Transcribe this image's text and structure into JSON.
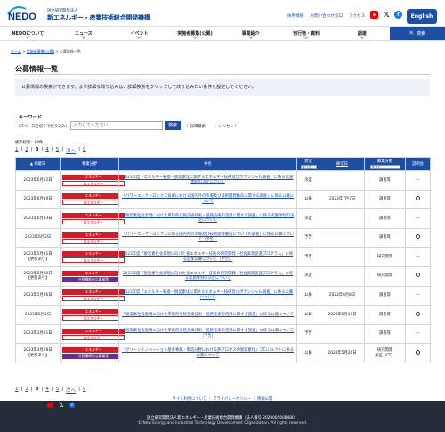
{
  "header": {
    "logo_text": "NEDO",
    "org_sub": "国立研究開発法人",
    "org_main": "新エネルギー・産業技術総合開発機構",
    "util_links": [
      "採用情報",
      "お問い合わせ窓口",
      "アクセス"
    ],
    "english_label": "English"
  },
  "nav": {
    "items": [
      "NEDOについて",
      "ニュース",
      "イベント",
      "実施者募集(公募)",
      "事業紹介",
      "刊行物・資料",
      "調達"
    ],
    "search_label": "🔍 検索"
  },
  "breadcrumb": [
    "ホーム",
    "実施者募集(公募)",
    "公募情報一覧"
  ],
  "page": {
    "title": "公募情報一覧",
    "intro": "公募情報の検索ができます。より詳細な絞り込みは、詳細検索をクリックして絞り込みたい条件を設定してください。"
  },
  "search": {
    "label": "キーワード",
    "sub_label": "(スペース区切りで絞り込み)",
    "placeholder": "入力してください",
    "button": "検索",
    "detail_label": "詳細検索",
    "reset_label": "リセット"
  },
  "results": {
    "count_text": "検索結果：88件",
    "pager": [
      "1",
      "2",
      "3",
      "4",
      "5",
      "次へ",
      "9"
    ],
    "current_page": "3"
  },
  "table": {
    "headers": {
      "date": "掲載日",
      "category": "事業分野",
      "title": "件名",
      "status": "状況",
      "status_filter": "すべて",
      "deadline": "締切日",
      "type": "募集分野",
      "type_filter": "すべて",
      "session": "説明会"
    },
    "rows": [
      {
        "date": "2023年6月22日",
        "cats": [
          {
            "t": "エネルギー",
            "k": "red"
          },
          {
            "t": "省エネルギー",
            "k": "outline"
          }
        ],
        "title": "2023年度「エネルギー転換・脱炭素化に関するエネルギー技術及びポテンシャル調査」に係る実施体制の決定について",
        "status": "決定",
        "deadline": "",
        "type": "調査等",
        "session": "—"
      },
      {
        "date": "2023年6月19日",
        "cats": [
          {
            "t": "エネルギー",
            "k": "red"
          },
          {
            "t": "省エネルギー",
            "k": "outline"
          }
        ],
        "title": "「パワーエレクトロニクス技術における国内外の市場及び技術開発動向に関する調査」に係る公募について",
        "status": "公募",
        "deadline": "2023年7月7日",
        "type": "調査等",
        "session": "○"
      },
      {
        "date": "2023年6月13日",
        "cats": [
          {
            "t": "エネルギー",
            "k": "red"
          },
          {
            "t": "省エネルギー",
            "k": "outline"
          }
        ],
        "title": "「脱炭素社会実現に向けた革新的な熱交換技術・低熱技術の活用に関する調査」に係る実施体制の決定について",
        "status": "決定",
        "deadline": "",
        "type": "調査等",
        "session": "—"
      },
      {
        "date": "2023年6月2日",
        "cats": [
          {
            "t": "エネルギー",
            "k": "red"
          },
          {
            "t": "省エネルギー",
            "k": "outline"
          }
        ],
        "title": "「パワーエレクトロニクスに係る国内外の市場及び技術開発動向についての調査」に係る公募について（予告）",
        "status": "予告",
        "deadline": "",
        "type": "調査等",
        "session": "○"
      },
      {
        "date": "2023年5月31日\n【更新あり】",
        "cats": [
          {
            "t": "エネルギー",
            "k": "red"
          },
          {
            "t": "省エネルギー",
            "k": "outline"
          }
        ],
        "title": "2023年度「脱炭素社会実現に向けた省エネルギー技術の研究開発・社会実装促進プログラム」に係る追加公募について（予告）",
        "status": "予告",
        "deadline": "",
        "type": "研究開発",
        "session": "—"
      },
      {
        "date": "2023年5月30日\n【更新あり】",
        "cats": [
          {
            "t": "エネルギー",
            "k": "red"
          },
          {
            "t": "分野横断的な事業等",
            "k": "purple"
          }
        ],
        "title": "2023年度「脱炭素社会実現に向けた省エネルギー技術の研究開発・社会実装促進プログラム」に係る実施体制の決定について",
        "status": "決定",
        "deadline": "",
        "type": "研究開発",
        "session": "○"
      },
      {
        "date": "2023年5月26日",
        "cats": [
          {
            "t": "エネルギー",
            "k": "red"
          },
          {
            "t": "省エネルギー",
            "k": "outline"
          }
        ],
        "title": "2023年度「エネルギー転換・脱炭素化に関するエネルギー技術及びポテンシャル調査」に係る公募について",
        "status": "公募",
        "deadline": "2023年6月8日",
        "type": "調査等",
        "session": "—"
      },
      {
        "date": "2023年5月1日",
        "cats": [
          {
            "t": "エネルギー",
            "k": "red"
          },
          {
            "t": "省エネルギー",
            "k": "outline"
          }
        ],
        "title": "「脱炭素社会実現に向けた革新的な熱交換技術・低熱技術の活用に関する調査」に係る公募について",
        "status": "公募",
        "deadline": "2023年5月30日",
        "type": "調査等",
        "session": "○"
      },
      {
        "date": "2023年3月31日",
        "cats": [
          {
            "t": "エネルギー",
            "k": "red"
          },
          {
            "t": "省エネルギー",
            "k": "outline"
          }
        ],
        "title": "「脱炭素社会実現に向けた革新的な熱交換技術・低熱技術の活用に関する調査」に係る公募について（予告）",
        "status": "予告",
        "deadline": "",
        "type": "調査等",
        "session": "—"
      },
      {
        "date": "2023年3月28日\n【更新あり】",
        "cats": [
          {
            "t": "エネルギー",
            "k": "red"
          },
          {
            "t": "分野横断的な事業等",
            "k": "purple"
          }
        ],
        "title": "「グリーンイノベーション基金事業／製造分野における熱プロセスの脱炭素化」プロジェクトに係る公募について",
        "status": "公募",
        "deadline": "2023年5月26日",
        "type": "研究開発\n実証（FT）",
        "session": "○"
      }
    ]
  },
  "footer": {
    "links": [
      "サイト利用について",
      "プライバシーポリシー",
      "情報公開"
    ],
    "org": "国立研究開発法人新エネルギー・産業技術総合開発機構（法人番号 2020005008480）",
    "copyright": "© New Energy and Industrial Technology Development Organization. All rights reserved."
  }
}
